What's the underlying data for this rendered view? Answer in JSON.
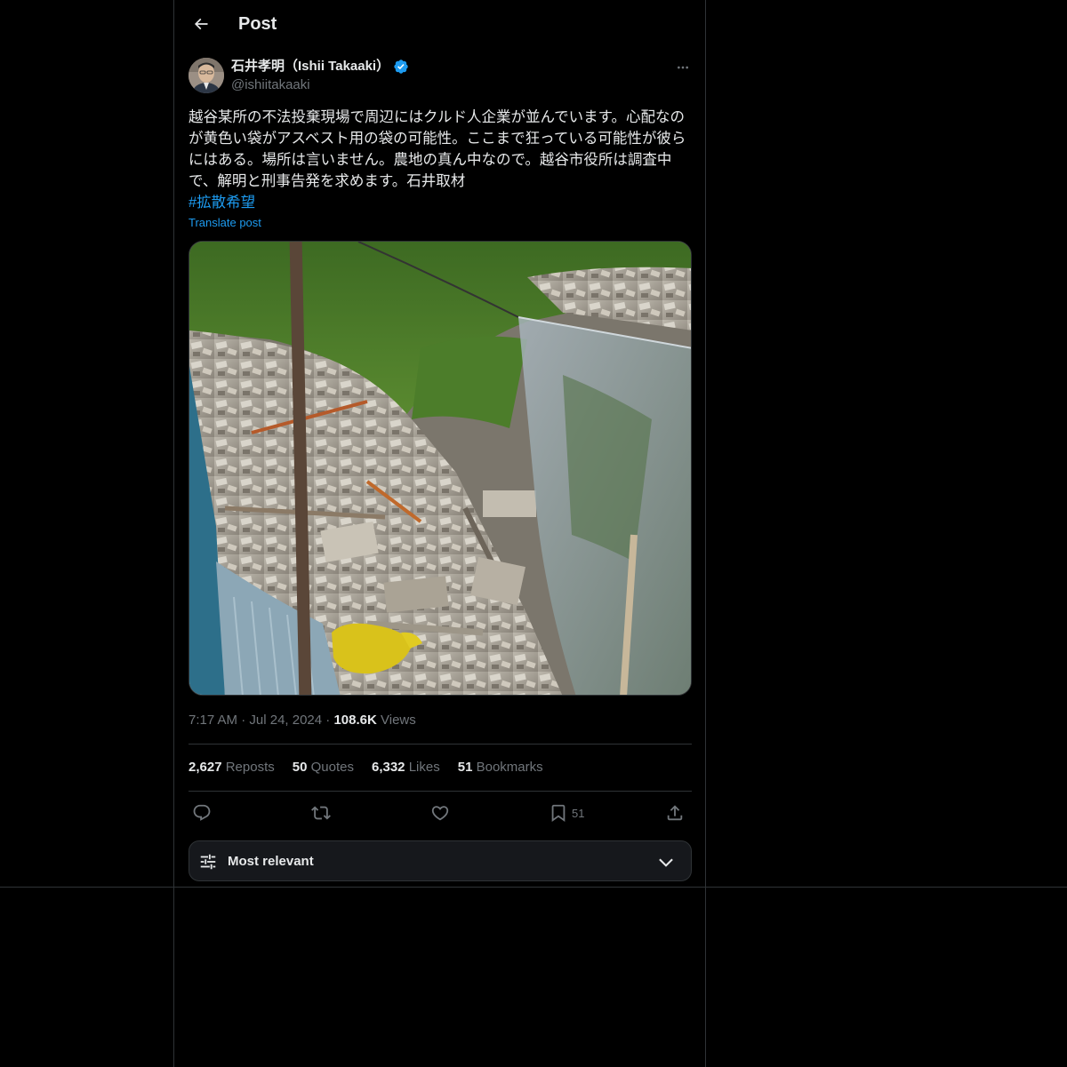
{
  "header": {
    "title": "Post"
  },
  "author": {
    "name": "石井孝明（Ishii Takaaki）",
    "handle": "@ishiitakaaki",
    "verified": true
  },
  "post": {
    "text": "越谷某所の不法投棄現場で周辺にはクルド人企業が並んでいます。心配なのが黄色い袋がアスベスト用の袋の可能性。ここまで狂っている可能性が彼らにはある。場所は言いません。農地の真ん中なので。越谷市役所は調査中で、解明と刑事告発を求めます。石井取材",
    "hashtag": "#拡散希望",
    "translate_label": "Translate post"
  },
  "meta": {
    "time": "7:17 AM",
    "separator": "·",
    "date": "Jul 24, 2024",
    "views_count": "108.6K",
    "views_label": "Views"
  },
  "stats": {
    "reposts_count": "2,627",
    "reposts_label": "Reposts",
    "quotes_count": "50",
    "quotes_label": "Quotes",
    "likes_count": "6,332",
    "likes_label": "Likes",
    "bookmarks_count": "51",
    "bookmarks_label": "Bookmarks"
  },
  "actions": {
    "bookmark_count": "51"
  },
  "sort": {
    "label": "Most relevant"
  },
  "colors": {
    "background": "#000000",
    "text": "#e7e9ea",
    "muted": "#71767b",
    "accent": "#1d9bf0",
    "border": "#2f3336"
  },
  "icons": [
    "back-arrow-icon",
    "verified-badge-icon",
    "more-icon",
    "reply-icon",
    "repost-icon",
    "like-icon",
    "bookmark-icon",
    "share-icon",
    "sort-sliders-icon",
    "chevron-down-icon"
  ]
}
